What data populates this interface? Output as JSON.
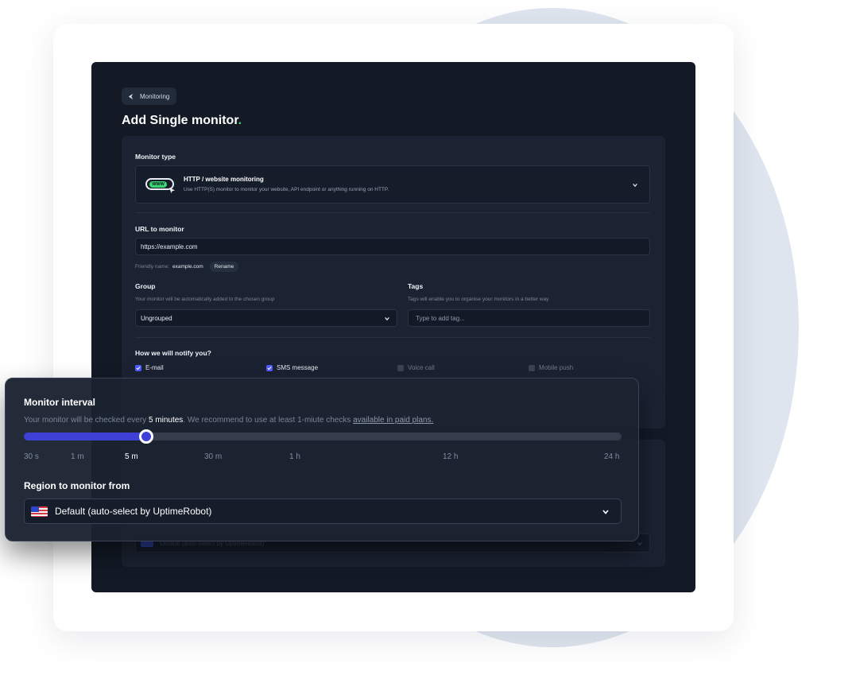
{
  "breadcrumb": {
    "label": "Monitoring"
  },
  "page": {
    "title": "Add Single monitor",
    "title_dot": "."
  },
  "monitor_type": {
    "label": "Monitor type",
    "icon_text": "WWW",
    "selected_title": "HTTP / website monitoring",
    "selected_desc": "Use HTTP(S) monitor to monitor your website, API endpoint or anything running on HTTP."
  },
  "url": {
    "label": "URL to monitor",
    "value": "https://example.com",
    "friendly_label": "Friendly name:",
    "friendly_value": "example.com",
    "rename_label": "Rename"
  },
  "group": {
    "label": "Group",
    "hint": "Your monitor will be automatically added to the chosen group",
    "value": "Ungrouped"
  },
  "tags": {
    "label": "Tags",
    "hint": "Tags will enable you to organise your monitors in a better way",
    "placeholder": "Type to add tag..."
  },
  "notify": {
    "label": "How we will notify you?",
    "options": [
      {
        "label": "E-mail",
        "checked": true
      },
      {
        "label": "SMS message",
        "checked": true
      },
      {
        "label": "Voice call",
        "checked": false
      },
      {
        "label": "Mobile push",
        "checked": false
      }
    ]
  },
  "background_region": {
    "value": "Default (auto-select by UptimeRobot)"
  },
  "interval": {
    "title": "Monitor interval",
    "desc_prefix": "Your monitor will be checked every",
    "desc_value": "5 minutes",
    "desc_suffix": ". We recommend to use at least 1-miute checks",
    "desc_link": "available in paid plans.",
    "slider_fraction": 0.205,
    "ticks": [
      "30 s",
      "1 m",
      "5 m",
      "30 m",
      "1 h",
      "12 h",
      "24 h"
    ],
    "active_tick": "5 m"
  },
  "region": {
    "title": "Region to monitor from",
    "value": "Default (auto-select by UptimeRobot)"
  },
  "colors": {
    "accent": "#3f40d6",
    "brand_green": "#3bd671",
    "app_bg": "#131a26",
    "panel_bg": "#1b2232"
  }
}
